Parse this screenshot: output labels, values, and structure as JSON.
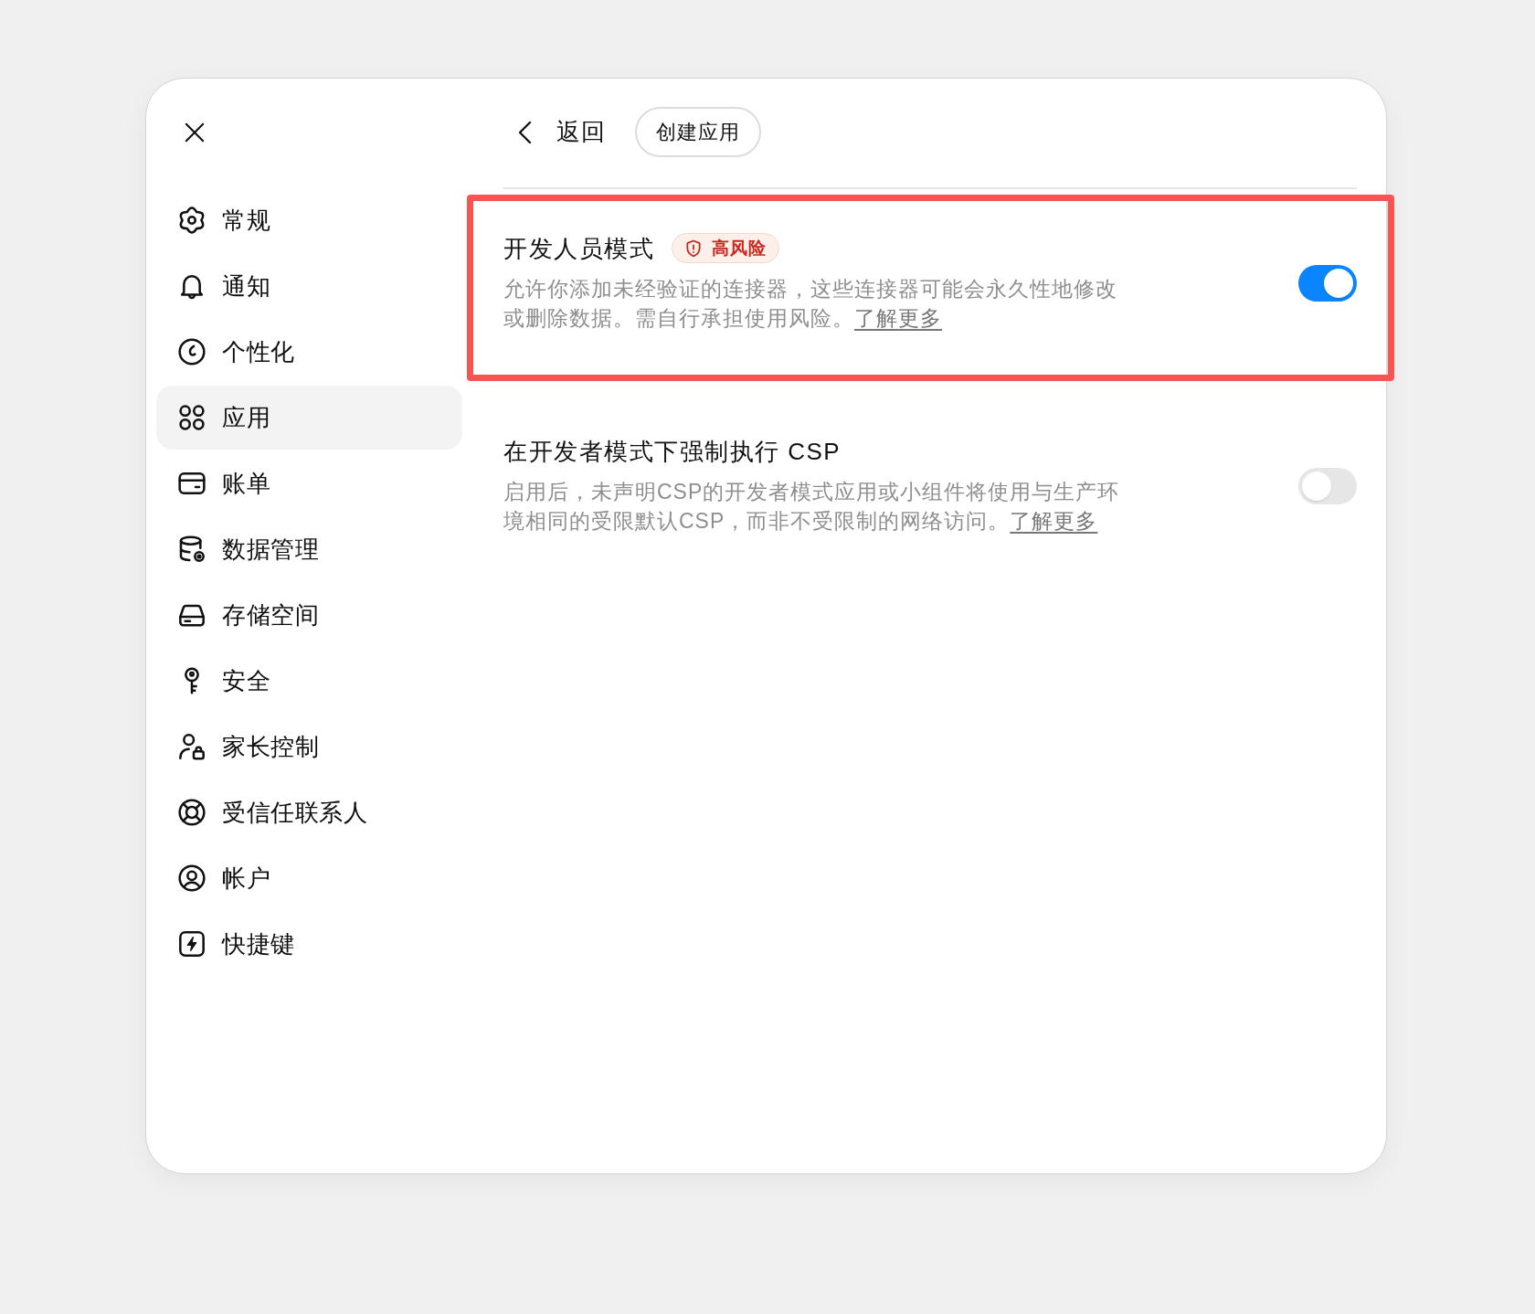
{
  "header": {
    "back_label": "返回",
    "action_label": "创建应用"
  },
  "sidebar": {
    "items": [
      {
        "label": "常规",
        "selected": false
      },
      {
        "label": "通知",
        "selected": false
      },
      {
        "label": "个性化",
        "selected": false
      },
      {
        "label": "应用",
        "selected": true
      },
      {
        "label": "账单",
        "selected": false
      },
      {
        "label": "数据管理",
        "selected": false
      },
      {
        "label": "存储空间",
        "selected": false
      },
      {
        "label": "安全",
        "selected": false
      },
      {
        "label": "家长控制",
        "selected": false
      },
      {
        "label": "受信任联系人",
        "selected": false
      },
      {
        "label": "帐户",
        "selected": false
      },
      {
        "label": "快捷键",
        "selected": false
      }
    ]
  },
  "settings": [
    {
      "title": "开发人员模式",
      "badge": "高风险",
      "description": "允许你添加未经验证的连接器，这些连接器可能会永久性地修改或删除数据。需自行承担使用风险。",
      "link": "了解更多",
      "on": true,
      "highlighted": true
    },
    {
      "title": "在开发者模式下强制执行 CSP",
      "description": "启用后，未声明CSP的开发者模式应用或小组件将使用与生产环境相同的受限默认CSP，而非不受限制的网络访问。",
      "link": "了解更多",
      "on": false,
      "highlighted": false
    }
  ]
}
